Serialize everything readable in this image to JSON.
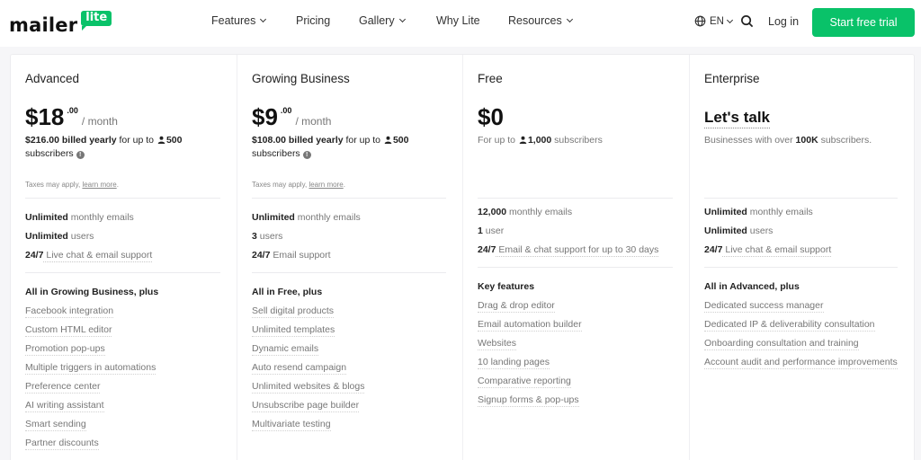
{
  "header": {
    "logo_word": "mailer",
    "logo_badge": "lite",
    "nav": [
      {
        "label": "Features",
        "dropdown": true
      },
      {
        "label": "Pricing",
        "dropdown": false
      },
      {
        "label": "Gallery",
        "dropdown": true
      },
      {
        "label": "Why Lite",
        "dropdown": false
      },
      {
        "label": "Resources",
        "dropdown": true
      }
    ],
    "language": "EN",
    "login_label": "Log in",
    "cta_label": "Start free trial",
    "brand_color": "#09c269"
  },
  "plans": [
    {
      "name": "Advanced",
      "price": "$18",
      "cents": ".00",
      "period": "/ month",
      "billing_amount": "$216.00 billed yearly",
      "billing_mid": " for up to ",
      "subscribers": "500",
      "billing_tail": "subscribers",
      "tax_note": "Taxes may apply, ",
      "tax_link": "learn more",
      "tax_end": ".",
      "stats": [
        {
          "bold": "Unlimited",
          "text": " monthly emails"
        },
        {
          "bold": "Unlimited",
          "text": " users"
        },
        {
          "bold": "24/7",
          "text": " Live chat & email support"
        }
      ],
      "features_heading": "All in Growing Business, plus",
      "features": [
        "Facebook integration",
        "Custom HTML editor",
        "Promotion pop-ups",
        "Multiple triggers in automations",
        "Preference center",
        "AI writing assistant",
        "Smart sending",
        "Partner discounts"
      ]
    },
    {
      "name": "Growing Business",
      "price": "$9",
      "cents": ".00",
      "period": "/ month",
      "billing_amount": "$108.00 billed yearly",
      "billing_mid": " for up to ",
      "subscribers": "500",
      "billing_tail": "subscribers",
      "tax_note": "Taxes may apply, ",
      "tax_link": "learn more",
      "tax_end": ".",
      "stats": [
        {
          "bold": "Unlimited",
          "text": " monthly emails"
        },
        {
          "bold": "3",
          "text": " users"
        },
        {
          "bold": "24/7",
          "text": " Email support"
        }
      ],
      "features_heading": "All in Free, plus",
      "features": [
        "Sell digital products",
        "Unlimited templates",
        "Dynamic emails",
        "Auto resend campaign",
        "Unlimited websites & blogs",
        "Unsubscribe page builder",
        "Multivariate testing"
      ]
    },
    {
      "name": "Free",
      "price": "$0",
      "billing_pre": "For up to ",
      "subscribers": "1,000",
      "billing_tail": " subscribers",
      "stats": [
        {
          "bold": "12,000",
          "text": " monthly emails"
        },
        {
          "bold": "1",
          "text": " user"
        },
        {
          "bold": "24/7",
          "text": " Email & chat support for up to 30 days"
        }
      ],
      "features_heading": "Key features",
      "features": [
        "Drag & drop editor",
        "Email automation builder",
        "Websites",
        "10 landing pages",
        "Comparative reporting",
        "Signup forms & pop-ups"
      ]
    },
    {
      "name": "Enterprise",
      "price_text": "Let's talk",
      "desc_pre": "Businesses with over ",
      "desc_bold": "100K",
      "desc_tail": " subscribers.",
      "stats": [
        {
          "bold": "Unlimited",
          "text": " monthly emails"
        },
        {
          "bold": "Unlimited",
          "text": " users"
        },
        {
          "bold": "24/7",
          "text": " Live chat & email support"
        }
      ],
      "features_heading": "All in Advanced, plus",
      "features": [
        "Dedicated success manager",
        "Dedicated IP & deliverability consultation",
        "Onboarding consultation and training",
        "Account audit and performance improvements"
      ]
    }
  ]
}
